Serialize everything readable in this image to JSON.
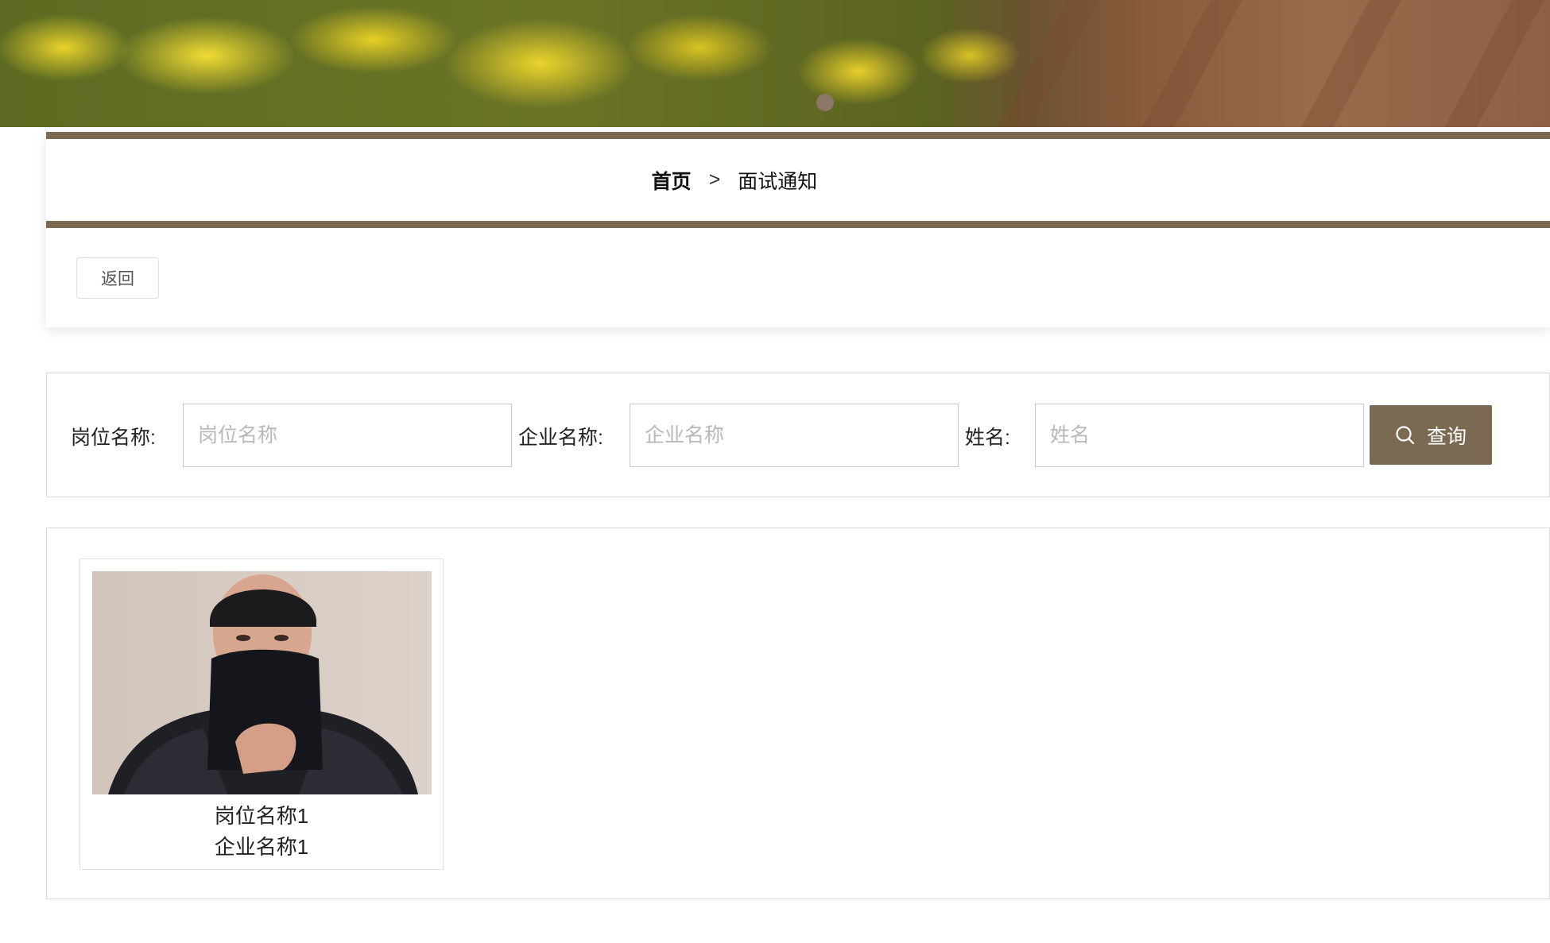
{
  "breadcrumb": {
    "home": "首页",
    "separator": ">",
    "current": "面试通知"
  },
  "back_button": "返回",
  "search": {
    "job_label": "岗位名称:",
    "job_placeholder": "岗位名称",
    "company_label": "企业名称:",
    "company_placeholder": "企业名称",
    "name_label": "姓名:",
    "name_placeholder": "姓名",
    "query_label": "查询"
  },
  "results": [
    {
      "job_title": "岗位名称1",
      "company": "企业名称1"
    }
  ],
  "colors": {
    "accent": "#7b6a52",
    "border": "#d9d9d9"
  },
  "icons": {
    "query": "search-icon"
  }
}
